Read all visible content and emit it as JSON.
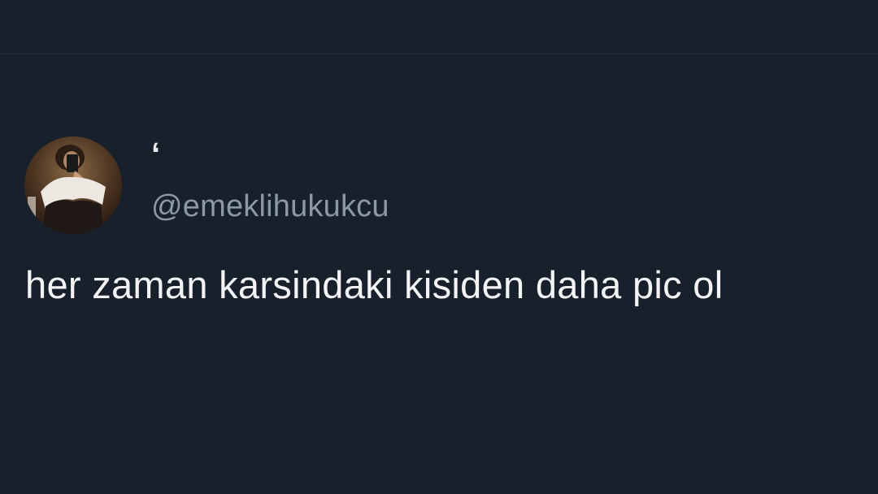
{
  "tweet": {
    "display_name": "‘",
    "handle": "@emeklihukukcu",
    "text": "her zaman karsindaki kisiden daha pic ol",
    "avatar": {
      "icon": "profile-photo"
    }
  },
  "colors": {
    "background": "#18202b",
    "primary_text": "#e7e9ea",
    "secondary_text": "#8b98a5"
  }
}
